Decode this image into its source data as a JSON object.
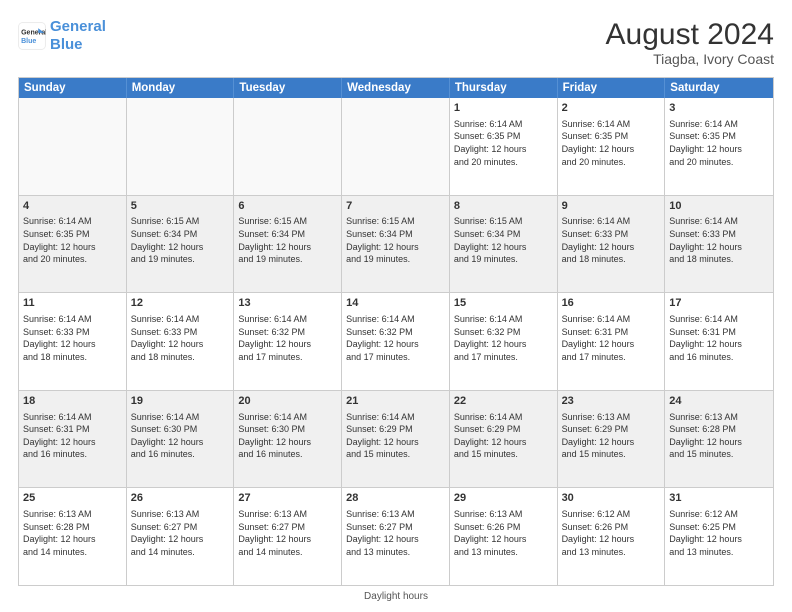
{
  "header": {
    "logo_line1": "General",
    "logo_line2": "Blue",
    "main_title": "August 2024",
    "subtitle": "Tiagba, Ivory Coast"
  },
  "days_of_week": [
    "Sunday",
    "Monday",
    "Tuesday",
    "Wednesday",
    "Thursday",
    "Friday",
    "Saturday"
  ],
  "weeks": [
    [
      {
        "day": "",
        "info": "",
        "empty": true
      },
      {
        "day": "",
        "info": "",
        "empty": true
      },
      {
        "day": "",
        "info": "",
        "empty": true
      },
      {
        "day": "",
        "info": "",
        "empty": true
      },
      {
        "day": "1",
        "info": "Sunrise: 6:14 AM\nSunset: 6:35 PM\nDaylight: 12 hours\nand 20 minutes.",
        "empty": false
      },
      {
        "day": "2",
        "info": "Sunrise: 6:14 AM\nSunset: 6:35 PM\nDaylight: 12 hours\nand 20 minutes.",
        "empty": false
      },
      {
        "day": "3",
        "info": "Sunrise: 6:14 AM\nSunset: 6:35 PM\nDaylight: 12 hours\nand 20 minutes.",
        "empty": false
      }
    ],
    [
      {
        "day": "4",
        "info": "Sunrise: 6:14 AM\nSunset: 6:35 PM\nDaylight: 12 hours\nand 20 minutes.",
        "empty": false
      },
      {
        "day": "5",
        "info": "Sunrise: 6:15 AM\nSunset: 6:34 PM\nDaylight: 12 hours\nand 19 minutes.",
        "empty": false
      },
      {
        "day": "6",
        "info": "Sunrise: 6:15 AM\nSunset: 6:34 PM\nDaylight: 12 hours\nand 19 minutes.",
        "empty": false
      },
      {
        "day": "7",
        "info": "Sunrise: 6:15 AM\nSunset: 6:34 PM\nDaylight: 12 hours\nand 19 minutes.",
        "empty": false
      },
      {
        "day": "8",
        "info": "Sunrise: 6:15 AM\nSunset: 6:34 PM\nDaylight: 12 hours\nand 19 minutes.",
        "empty": false
      },
      {
        "day": "9",
        "info": "Sunrise: 6:14 AM\nSunset: 6:33 PM\nDaylight: 12 hours\nand 18 minutes.",
        "empty": false
      },
      {
        "day": "10",
        "info": "Sunrise: 6:14 AM\nSunset: 6:33 PM\nDaylight: 12 hours\nand 18 minutes.",
        "empty": false
      }
    ],
    [
      {
        "day": "11",
        "info": "Sunrise: 6:14 AM\nSunset: 6:33 PM\nDaylight: 12 hours\nand 18 minutes.",
        "empty": false
      },
      {
        "day": "12",
        "info": "Sunrise: 6:14 AM\nSunset: 6:33 PM\nDaylight: 12 hours\nand 18 minutes.",
        "empty": false
      },
      {
        "day": "13",
        "info": "Sunrise: 6:14 AM\nSunset: 6:32 PM\nDaylight: 12 hours\nand 17 minutes.",
        "empty": false
      },
      {
        "day": "14",
        "info": "Sunrise: 6:14 AM\nSunset: 6:32 PM\nDaylight: 12 hours\nand 17 minutes.",
        "empty": false
      },
      {
        "day": "15",
        "info": "Sunrise: 6:14 AM\nSunset: 6:32 PM\nDaylight: 12 hours\nand 17 minutes.",
        "empty": false
      },
      {
        "day": "16",
        "info": "Sunrise: 6:14 AM\nSunset: 6:31 PM\nDaylight: 12 hours\nand 17 minutes.",
        "empty": false
      },
      {
        "day": "17",
        "info": "Sunrise: 6:14 AM\nSunset: 6:31 PM\nDaylight: 12 hours\nand 16 minutes.",
        "empty": false
      }
    ],
    [
      {
        "day": "18",
        "info": "Sunrise: 6:14 AM\nSunset: 6:31 PM\nDaylight: 12 hours\nand 16 minutes.",
        "empty": false
      },
      {
        "day": "19",
        "info": "Sunrise: 6:14 AM\nSunset: 6:30 PM\nDaylight: 12 hours\nand 16 minutes.",
        "empty": false
      },
      {
        "day": "20",
        "info": "Sunrise: 6:14 AM\nSunset: 6:30 PM\nDaylight: 12 hours\nand 16 minutes.",
        "empty": false
      },
      {
        "day": "21",
        "info": "Sunrise: 6:14 AM\nSunset: 6:29 PM\nDaylight: 12 hours\nand 15 minutes.",
        "empty": false
      },
      {
        "day": "22",
        "info": "Sunrise: 6:14 AM\nSunset: 6:29 PM\nDaylight: 12 hours\nand 15 minutes.",
        "empty": false
      },
      {
        "day": "23",
        "info": "Sunrise: 6:13 AM\nSunset: 6:29 PM\nDaylight: 12 hours\nand 15 minutes.",
        "empty": false
      },
      {
        "day": "24",
        "info": "Sunrise: 6:13 AM\nSunset: 6:28 PM\nDaylight: 12 hours\nand 15 minutes.",
        "empty": false
      }
    ],
    [
      {
        "day": "25",
        "info": "Sunrise: 6:13 AM\nSunset: 6:28 PM\nDaylight: 12 hours\nand 14 minutes.",
        "empty": false
      },
      {
        "day": "26",
        "info": "Sunrise: 6:13 AM\nSunset: 6:27 PM\nDaylight: 12 hours\nand 14 minutes.",
        "empty": false
      },
      {
        "day": "27",
        "info": "Sunrise: 6:13 AM\nSunset: 6:27 PM\nDaylight: 12 hours\nand 14 minutes.",
        "empty": false
      },
      {
        "day": "28",
        "info": "Sunrise: 6:13 AM\nSunset: 6:27 PM\nDaylight: 12 hours\nand 13 minutes.",
        "empty": false
      },
      {
        "day": "29",
        "info": "Sunrise: 6:13 AM\nSunset: 6:26 PM\nDaylight: 12 hours\nand 13 minutes.",
        "empty": false
      },
      {
        "day": "30",
        "info": "Sunrise: 6:12 AM\nSunset: 6:26 PM\nDaylight: 12 hours\nand 13 minutes.",
        "empty": false
      },
      {
        "day": "31",
        "info": "Sunrise: 6:12 AM\nSunset: 6:25 PM\nDaylight: 12 hours\nand 13 minutes.",
        "empty": false
      }
    ]
  ],
  "footer": "Daylight hours"
}
